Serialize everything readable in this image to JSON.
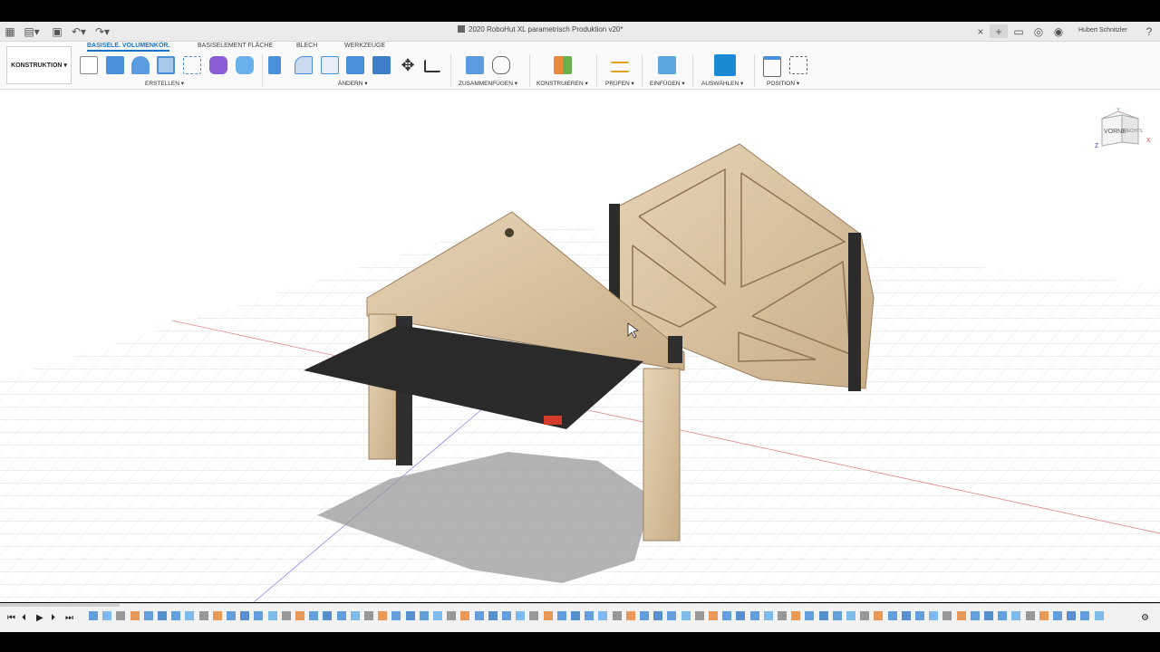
{
  "title_bar": {
    "document_title": "2020 RoboHut XL parametrisch Produktion v20*",
    "close_tab": "×",
    "new_tab": "+",
    "user_name": "Hubert Schnitzler"
  },
  "workspace": {
    "label": "KONSTRUKTION ▾"
  },
  "tabs": [
    {
      "label": "BASISELE. VOLUMENKÖR."
    },
    {
      "label": "BASISELEMENT FLÄCHE"
    },
    {
      "label": "BLECH"
    },
    {
      "label": "WERKZEUGE"
    }
  ],
  "groups": [
    {
      "label": "ERSTELLEN ▾"
    },
    {
      "label": "ÄNDERN ▾"
    },
    {
      "label": "ZUSAMMENFÜGEN ▾"
    },
    {
      "label": "KONSTRUIEREN ▾"
    },
    {
      "label": "PRÜFEN ▾"
    },
    {
      "label": "EINFÜGEN ▾"
    },
    {
      "label": "AUSWÄHLEN ▾"
    },
    {
      "label": "POSITION ▾"
    }
  ],
  "viewcube": {
    "face_front": "VORNE",
    "face_right": "RECHTS",
    "axis_x": "X",
    "axis_y": "Y",
    "axis_z": "Z"
  },
  "colors": {
    "accent": "#1a73c9",
    "wood": "#d9c4a4",
    "dark_panel": "#2a2a2a"
  }
}
